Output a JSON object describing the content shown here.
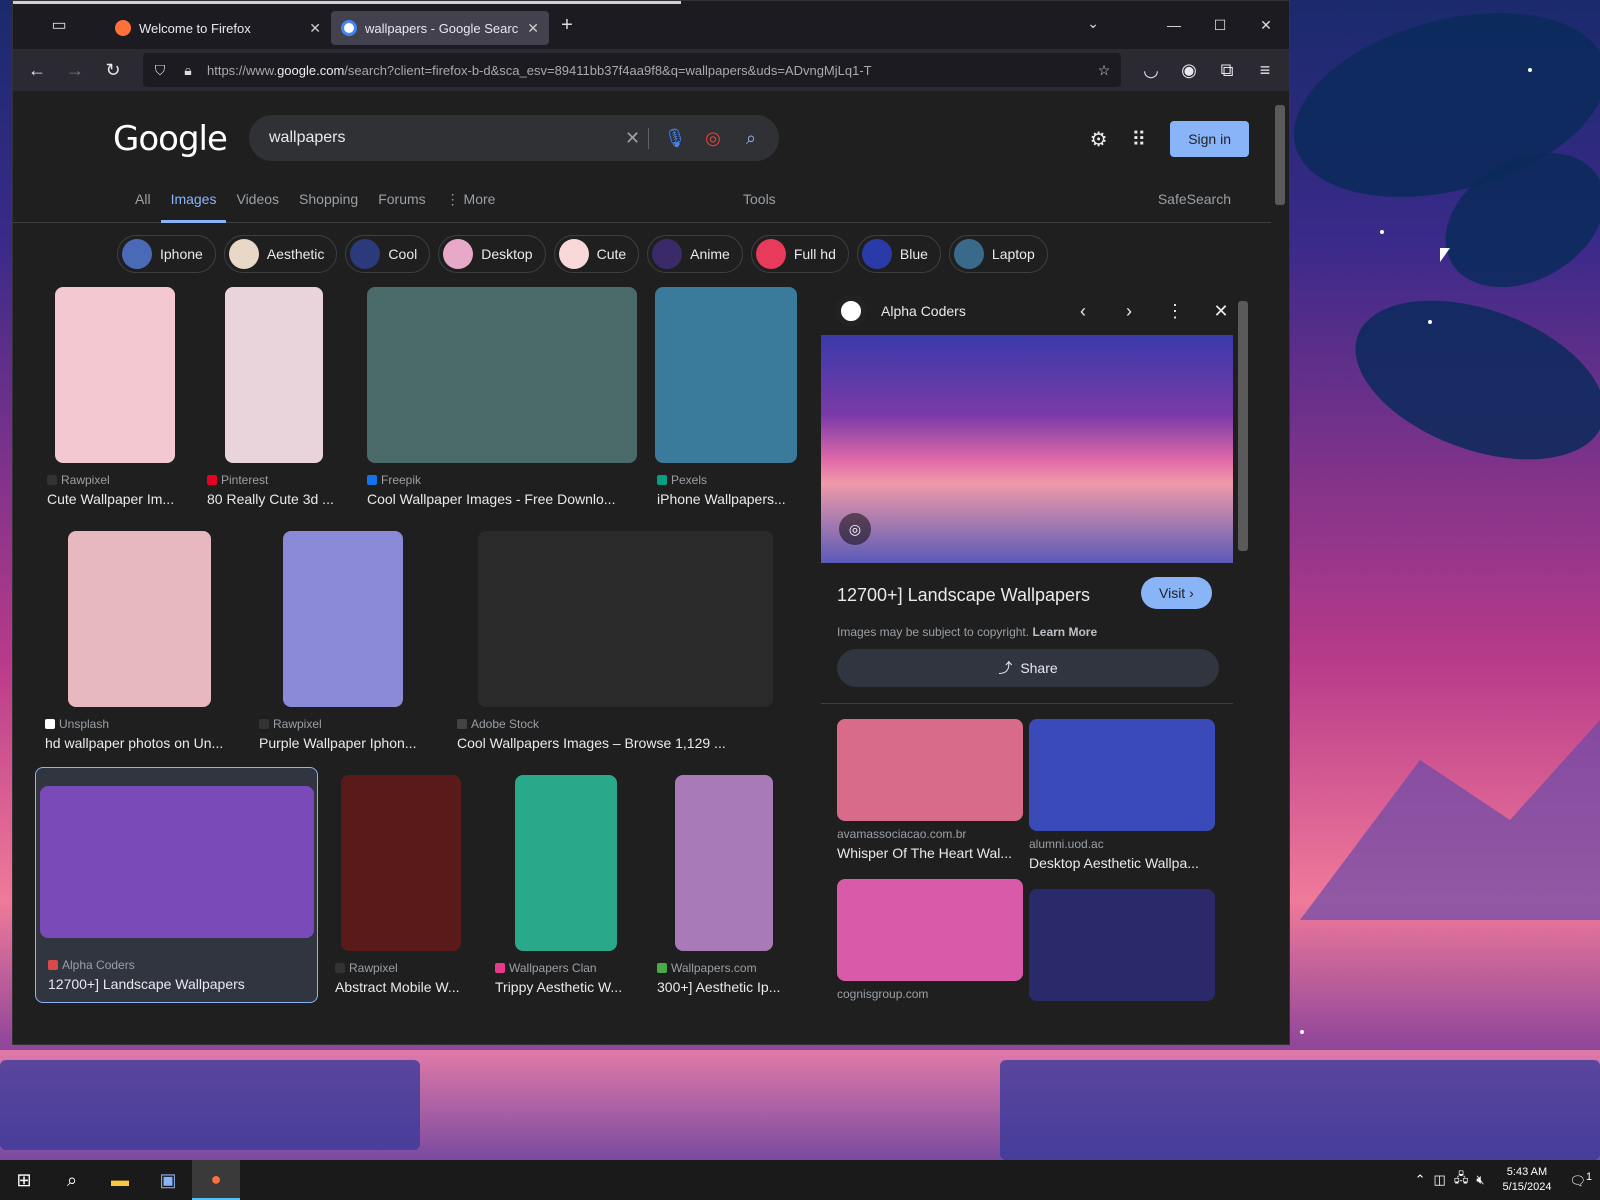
{
  "browser": {
    "tabs": [
      {
        "title": "Welcome to Firefox",
        "favicon_color": "#ff7139",
        "active": false
      },
      {
        "title": "wallpapers - Google Search",
        "favicon_color": "#ffffff",
        "active": true
      }
    ],
    "url_prefix": "https://www.",
    "url_domain": "google.com",
    "url_rest": "/search?client=firefox-b-d&sca_esv=89411bb37f4aa9f8&q=wallpapers&uds=ADvngMjLq1-T"
  },
  "google": {
    "logo": "Google",
    "query": "wallpapers",
    "sign_in": "Sign in",
    "nav": [
      "All",
      "Images",
      "Videos",
      "Shopping",
      "Forums",
      "⋮ More"
    ],
    "active_nav": "Images",
    "tools": "Tools",
    "safesearch": "SafeSearch",
    "chips": [
      {
        "label": "Iphone",
        "color": "#4a6ab8"
      },
      {
        "label": "Aesthetic",
        "color": "#e8d8c8"
      },
      {
        "label": "Cool",
        "color": "#2a3a7a"
      },
      {
        "label": "Desktop",
        "color": "#e8a8c8"
      },
      {
        "label": "Cute",
        "color": "#f8d8d8"
      },
      {
        "label": "Anime",
        "color": "#3a2a6a"
      },
      {
        "label": "Full hd",
        "color": "#e83a5a"
      },
      {
        "label": "Blue",
        "color": "#2a3aa8"
      },
      {
        "label": "Laptop",
        "color": "#3a6a8a"
      }
    ],
    "results": [
      {
        "source": "Rawpixel",
        "title": "Cute Wallpaper Im...",
        "color": "#f4c8d0",
        "fav": "#333"
      },
      {
        "source": "Pinterest",
        "title": "80 Really Cute 3d ...",
        "color": "#ead4dc",
        "fav": "#e60023"
      },
      {
        "source": "Freepik",
        "title": "Cool Wallpaper Images - Free Downlo...",
        "color": "#4a6a6a",
        "fav": "#1273eb"
      },
      {
        "source": "Pexels",
        "title": "iPhone Wallpapers...",
        "color": "#3a7a9a",
        "fav": "#05a081"
      },
      {
        "source": "Unsplash",
        "title": "hd wallpaper photos on Un...",
        "color": "#e8b8c0",
        "fav": "#fff"
      },
      {
        "source": "Rawpixel",
        "title": "Purple Wallpaper Iphon...",
        "color": "#8a8ad8",
        "fav": "#333"
      },
      {
        "source": "Adobe Stock",
        "title": "Cool Wallpapers Images – Browse 1,129 ...",
        "color": "#2a2a2a",
        "fav": "#444"
      },
      {
        "source": "Alpha Coders",
        "title": "12700+] Landscape Wallpapers",
        "color": "#7a4ab8",
        "fav": "#d84a4a"
      },
      {
        "source": "Rawpixel",
        "title": "Abstract Mobile W...",
        "color": "#5a1a1a",
        "fav": "#333"
      },
      {
        "source": "Wallpapers Clan",
        "title": "Trippy Aesthetic W...",
        "color": "#2aa88a",
        "fav": "#e83a8a"
      },
      {
        "source": "Wallpapers.com",
        "title": "300+] Aesthetic Ip...",
        "color": "#a87ab8",
        "fav": "#4aaa4a"
      }
    ],
    "panel": {
      "site": "Alpha Coders",
      "title": "12700+] Landscape Wallpapers",
      "visit": "Visit ›",
      "copyright": "Images may be subject to copyright.",
      "learn_more": "Learn More",
      "share": "Share",
      "related": [
        {
          "source": "avamassociacao.com.br",
          "title": "Whisper Of The Heart Wal...",
          "color": "#d86a8a"
        },
        {
          "source": "alumni.uod.ac",
          "title": "Desktop Aesthetic Wallpa...",
          "color": "#3a4ab8"
        },
        {
          "source": "cognisgroup.com",
          "title": "",
          "color": "#d85aa8"
        },
        {
          "source": "",
          "title": "",
          "color": "#2a2a6a"
        }
      ]
    }
  },
  "taskbar": {
    "time": "5:43 AM",
    "date": "5/15/2024",
    "notifications": "1"
  }
}
